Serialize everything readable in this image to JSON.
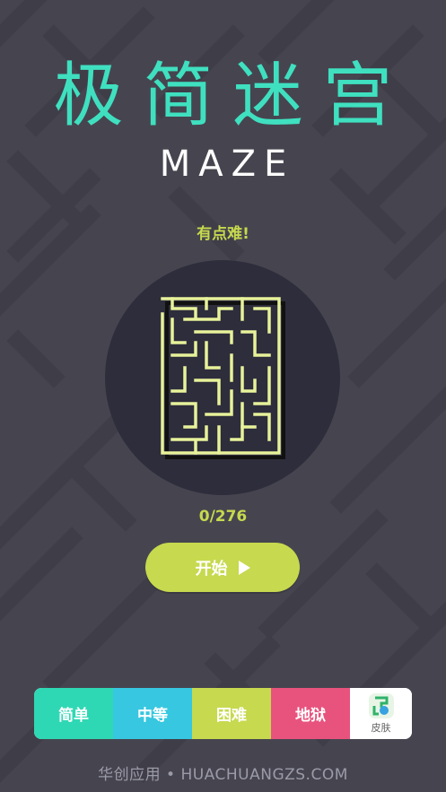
{
  "title": {
    "chinese": "极简迷宫",
    "english": "MAZE"
  },
  "difficulty_label": "有点难!",
  "progress": "0/276",
  "start_button": {
    "label": "开始"
  },
  "levels": [
    {
      "label": "简单",
      "color": "#2fd8b4"
    },
    {
      "label": "中等",
      "color": "#37c7e0"
    },
    {
      "label": "困难",
      "color": "#c7d94e"
    },
    {
      "label": "地狱",
      "color": "#e8537e"
    }
  ],
  "skin_button": {
    "label": "皮肤",
    "icon": "skin-icon"
  },
  "footer": "华创应用 • HUACHUANGZS.COM",
  "colors": {
    "accent": "#c7d94e",
    "title": "#3fe0c0",
    "background": "#46454f",
    "circle": "#2e2d3c"
  }
}
